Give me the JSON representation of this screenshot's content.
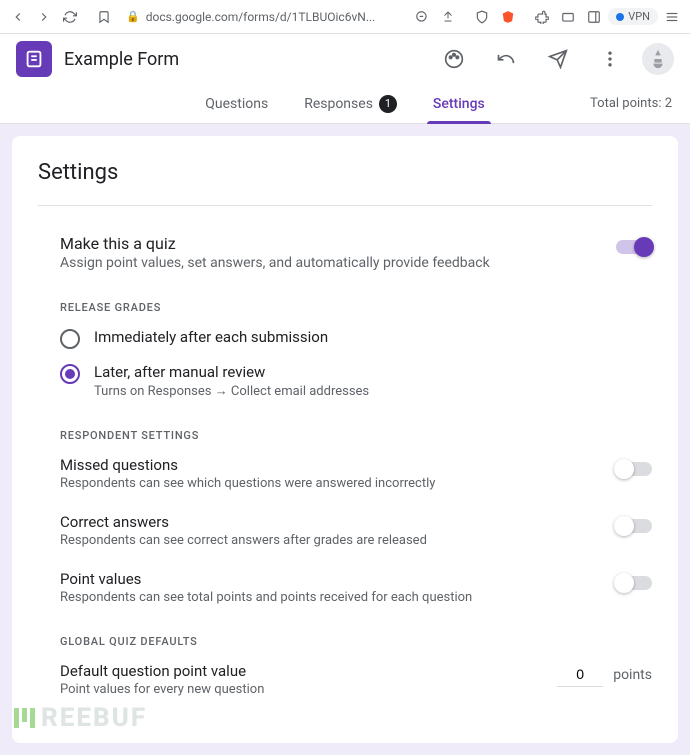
{
  "browser": {
    "url": "docs.google.com/forms/d/1TLBUOic6vN...",
    "vpn": "VPN"
  },
  "header": {
    "title": "Example Form"
  },
  "tabs": {
    "questions": "Questions",
    "responses": "Responses",
    "responses_count": "1",
    "settings": "Settings",
    "total_points": "Total points: 2"
  },
  "settings": {
    "title": "Settings",
    "quiz": {
      "label": "Make this a quiz",
      "desc": "Assign point values, set answers, and automatically provide feedback",
      "on": true
    },
    "release_grades": {
      "header": "RELEASE GRADES",
      "opt1": {
        "label": "Immediately after each submission"
      },
      "opt2": {
        "label": "Later, after manual review",
        "sub": "Turns on Responses → Collect email addresses"
      },
      "selected": "opt2"
    },
    "respondent": {
      "header": "RESPONDENT SETTINGS",
      "missed": {
        "label": "Missed questions",
        "desc": "Respondents can see which questions were answered incorrectly",
        "on": false
      },
      "correct": {
        "label": "Correct answers",
        "desc": "Respondents can see correct answers after grades are released",
        "on": false
      },
      "points": {
        "label": "Point values",
        "desc": "Respondents can see total points and points received for each question",
        "on": false
      }
    },
    "global": {
      "header": "GLOBAL QUIZ DEFAULTS",
      "default_point": {
        "label": "Default question point value",
        "desc": "Point values for every new question",
        "value": "0",
        "suffix": "points"
      }
    }
  },
  "watermark": "REEBUF"
}
